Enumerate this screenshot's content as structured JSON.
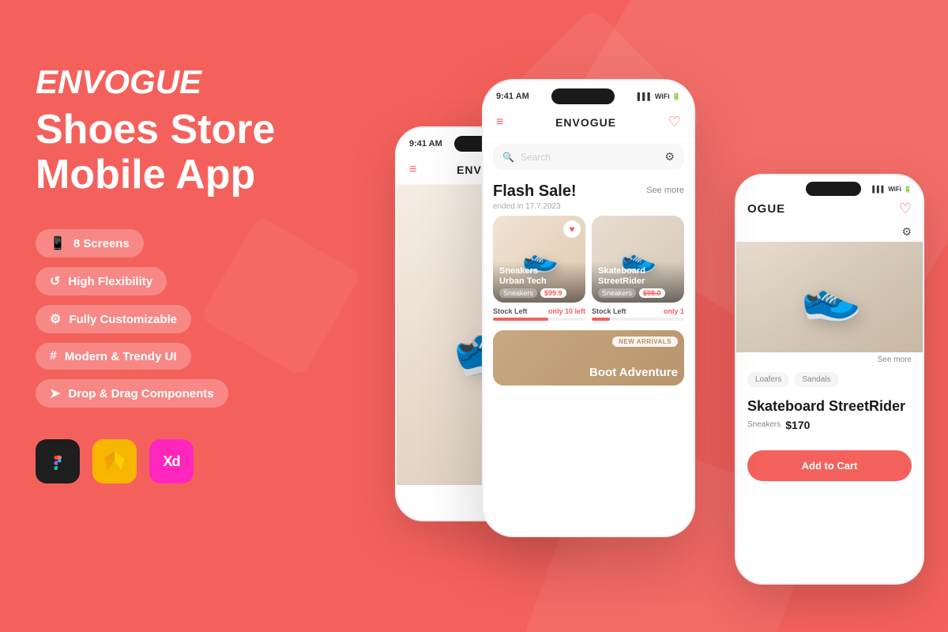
{
  "brand": {
    "name": "ENVOGUE",
    "tagline_line1": "Shoes Store",
    "tagline_line2": "Mobile App"
  },
  "features": [
    {
      "id": "screens",
      "icon": "📱",
      "label": "8 Screens"
    },
    {
      "id": "flexibility",
      "icon": "🔁",
      "label": "High Flexibility"
    },
    {
      "id": "customizable",
      "icon": "⚙️",
      "label": "Fully Customizable"
    },
    {
      "id": "modern",
      "icon": "#",
      "label": "Modern & Trendy UI"
    },
    {
      "id": "drag",
      "icon": "➤",
      "label": "Drop & Drag Components"
    }
  ],
  "tools": [
    {
      "id": "figma",
      "icon": "Ⓕ",
      "label": "Figma"
    },
    {
      "id": "sketch",
      "icon": "◇",
      "label": "Sketch"
    },
    {
      "id": "xd",
      "icon": "Xd",
      "label": "Adobe XD"
    }
  ],
  "phone_mid": {
    "status_time": "9:41 AM",
    "logo": "ENVOGUE",
    "search_placeholder": "Search",
    "flash_sale_title": "Flash Sale!",
    "flash_sale_see_more": "See more",
    "flash_sale_subtitle": "ended in 17.7.2023",
    "products": [
      {
        "name": "Sneakers Urban Tech",
        "category": "Sneakers",
        "price": "$99.9",
        "stock_label": "Stock Left",
        "stock_amount": "only 10 left",
        "stock_percent": 60,
        "bg": "sneaker"
      },
      {
        "name": "Skateboard StreetRider",
        "category": "Sneakers",
        "price": "$98.0",
        "stock_label": "Stock Left",
        "stock_amount": "only 1",
        "stock_percent": 20,
        "bg": "skate"
      }
    ],
    "new_arrivals_badge": "NEW ARRIVALS",
    "new_arrivals_title": "Boot Adventure"
  },
  "phone_back": {
    "status_time": "9:41 AM",
    "logo": "ENVOGUE"
  },
  "phone_front": {
    "logo": "OGUE",
    "product_name": "Skateboard StreetRider",
    "category": "Sneakers",
    "price": "$170",
    "see_more": "See more",
    "cat1": "Loafers",
    "cat2": "Sandals",
    "add_to_cart": "Add to Cart"
  },
  "accent_color": "#F4615C",
  "bg_color": "#F4615C"
}
